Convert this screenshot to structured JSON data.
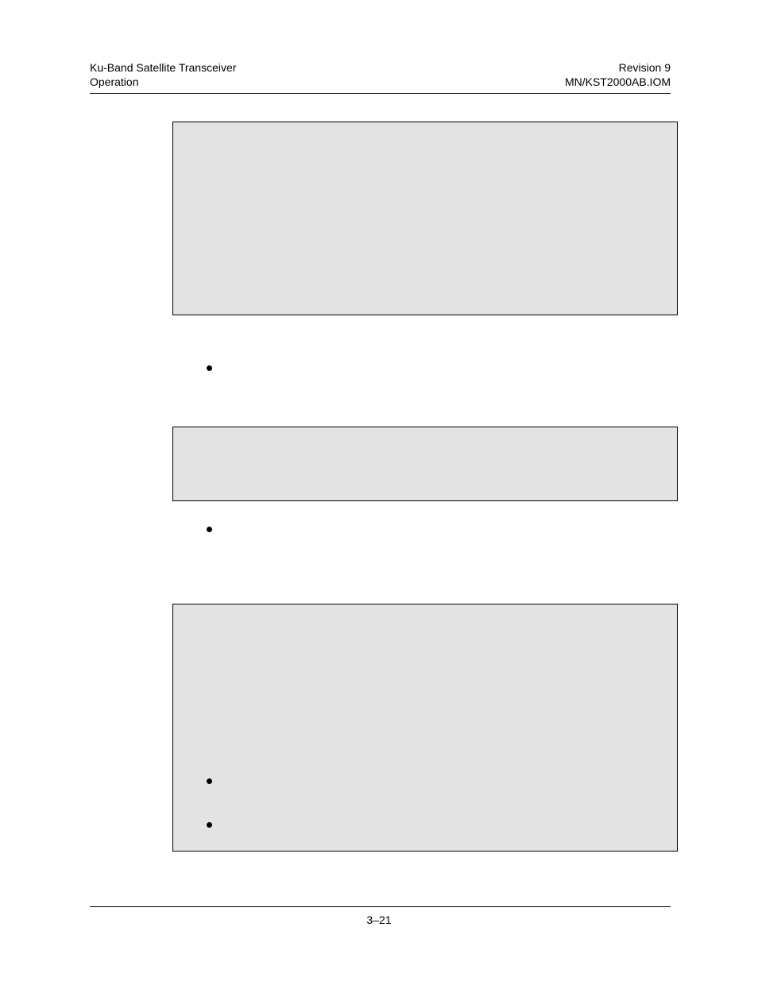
{
  "header": {
    "left_line1": "Ku-Band Satellite Transceiver",
    "left_line2": "Operation",
    "right_line1": "Revision 9",
    "right_line2": "MN/KST2000AB.IOM"
  },
  "footer": {
    "page_number": "3–21"
  }
}
